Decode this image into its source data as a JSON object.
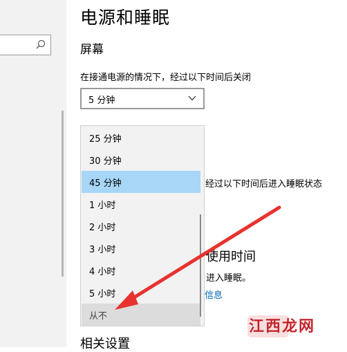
{
  "page": {
    "title": "电源和睡眠",
    "screen_section": "屏幕",
    "screen_label": "在接通电源的情况下，经过以下时间后关闭",
    "selected_value": "5 分钟",
    "sleep_label_partial": "经过以下时间后进入睡眠状态",
    "usage_title_partial": "使用时间",
    "usage_desc_partial": "进入睡眠。",
    "info_link_partial": "信息",
    "related_title_partial": "相关设置"
  },
  "dropdown": {
    "options": [
      "25 分钟",
      "30 分钟",
      "45 分钟",
      "1 小时",
      "2 小时",
      "3 小时",
      "4 小时",
      "5 小时",
      "从不"
    ],
    "selected_index": 2,
    "hovered_index": 8
  },
  "colors": {
    "selected_bg": "#a7d6f7",
    "never_bg": "#dcdcdc",
    "arrow": "#e8322e",
    "link": "#0063b1"
  },
  "watermark": "江西龙网"
}
